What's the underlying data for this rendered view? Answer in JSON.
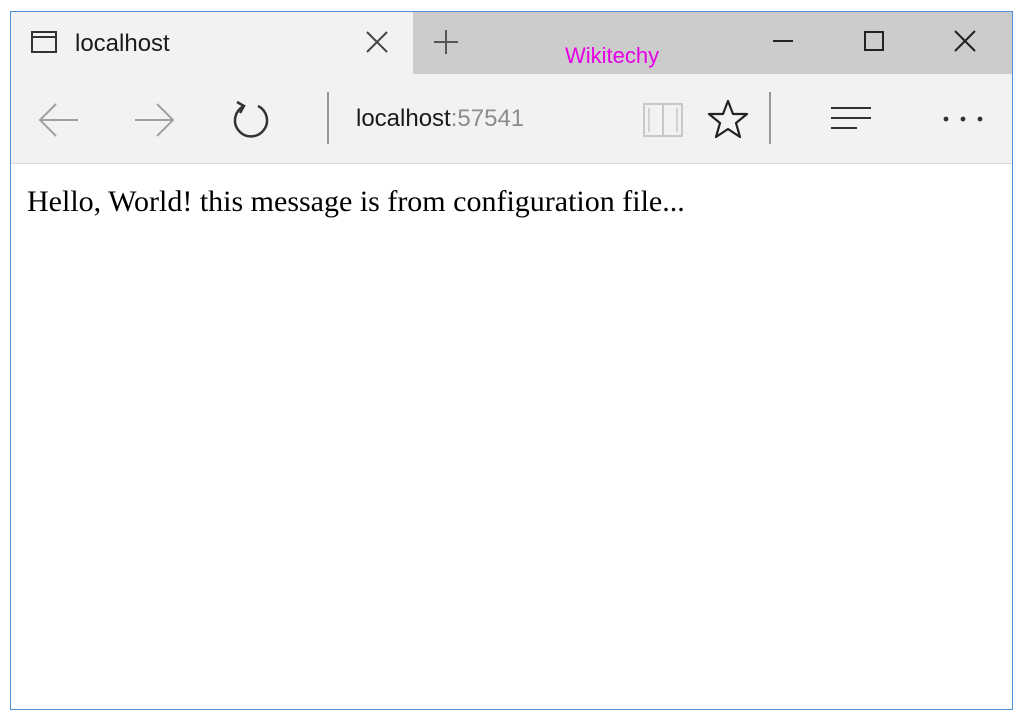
{
  "tab": {
    "title": "localhost",
    "icon": "browser-tab-icon"
  },
  "watermark": "Wikitechy",
  "address_bar": {
    "host": "localhost",
    "port": ":57541"
  },
  "page": {
    "message": "Hello, World! this message is from configuration file..."
  },
  "colors": {
    "watermark": "#e600e6",
    "window_border": "#4a90d9",
    "tabstrip_bg": "#cccccc",
    "toolbar_bg": "#f2f2f2",
    "port_text": "#8c8c8c"
  }
}
